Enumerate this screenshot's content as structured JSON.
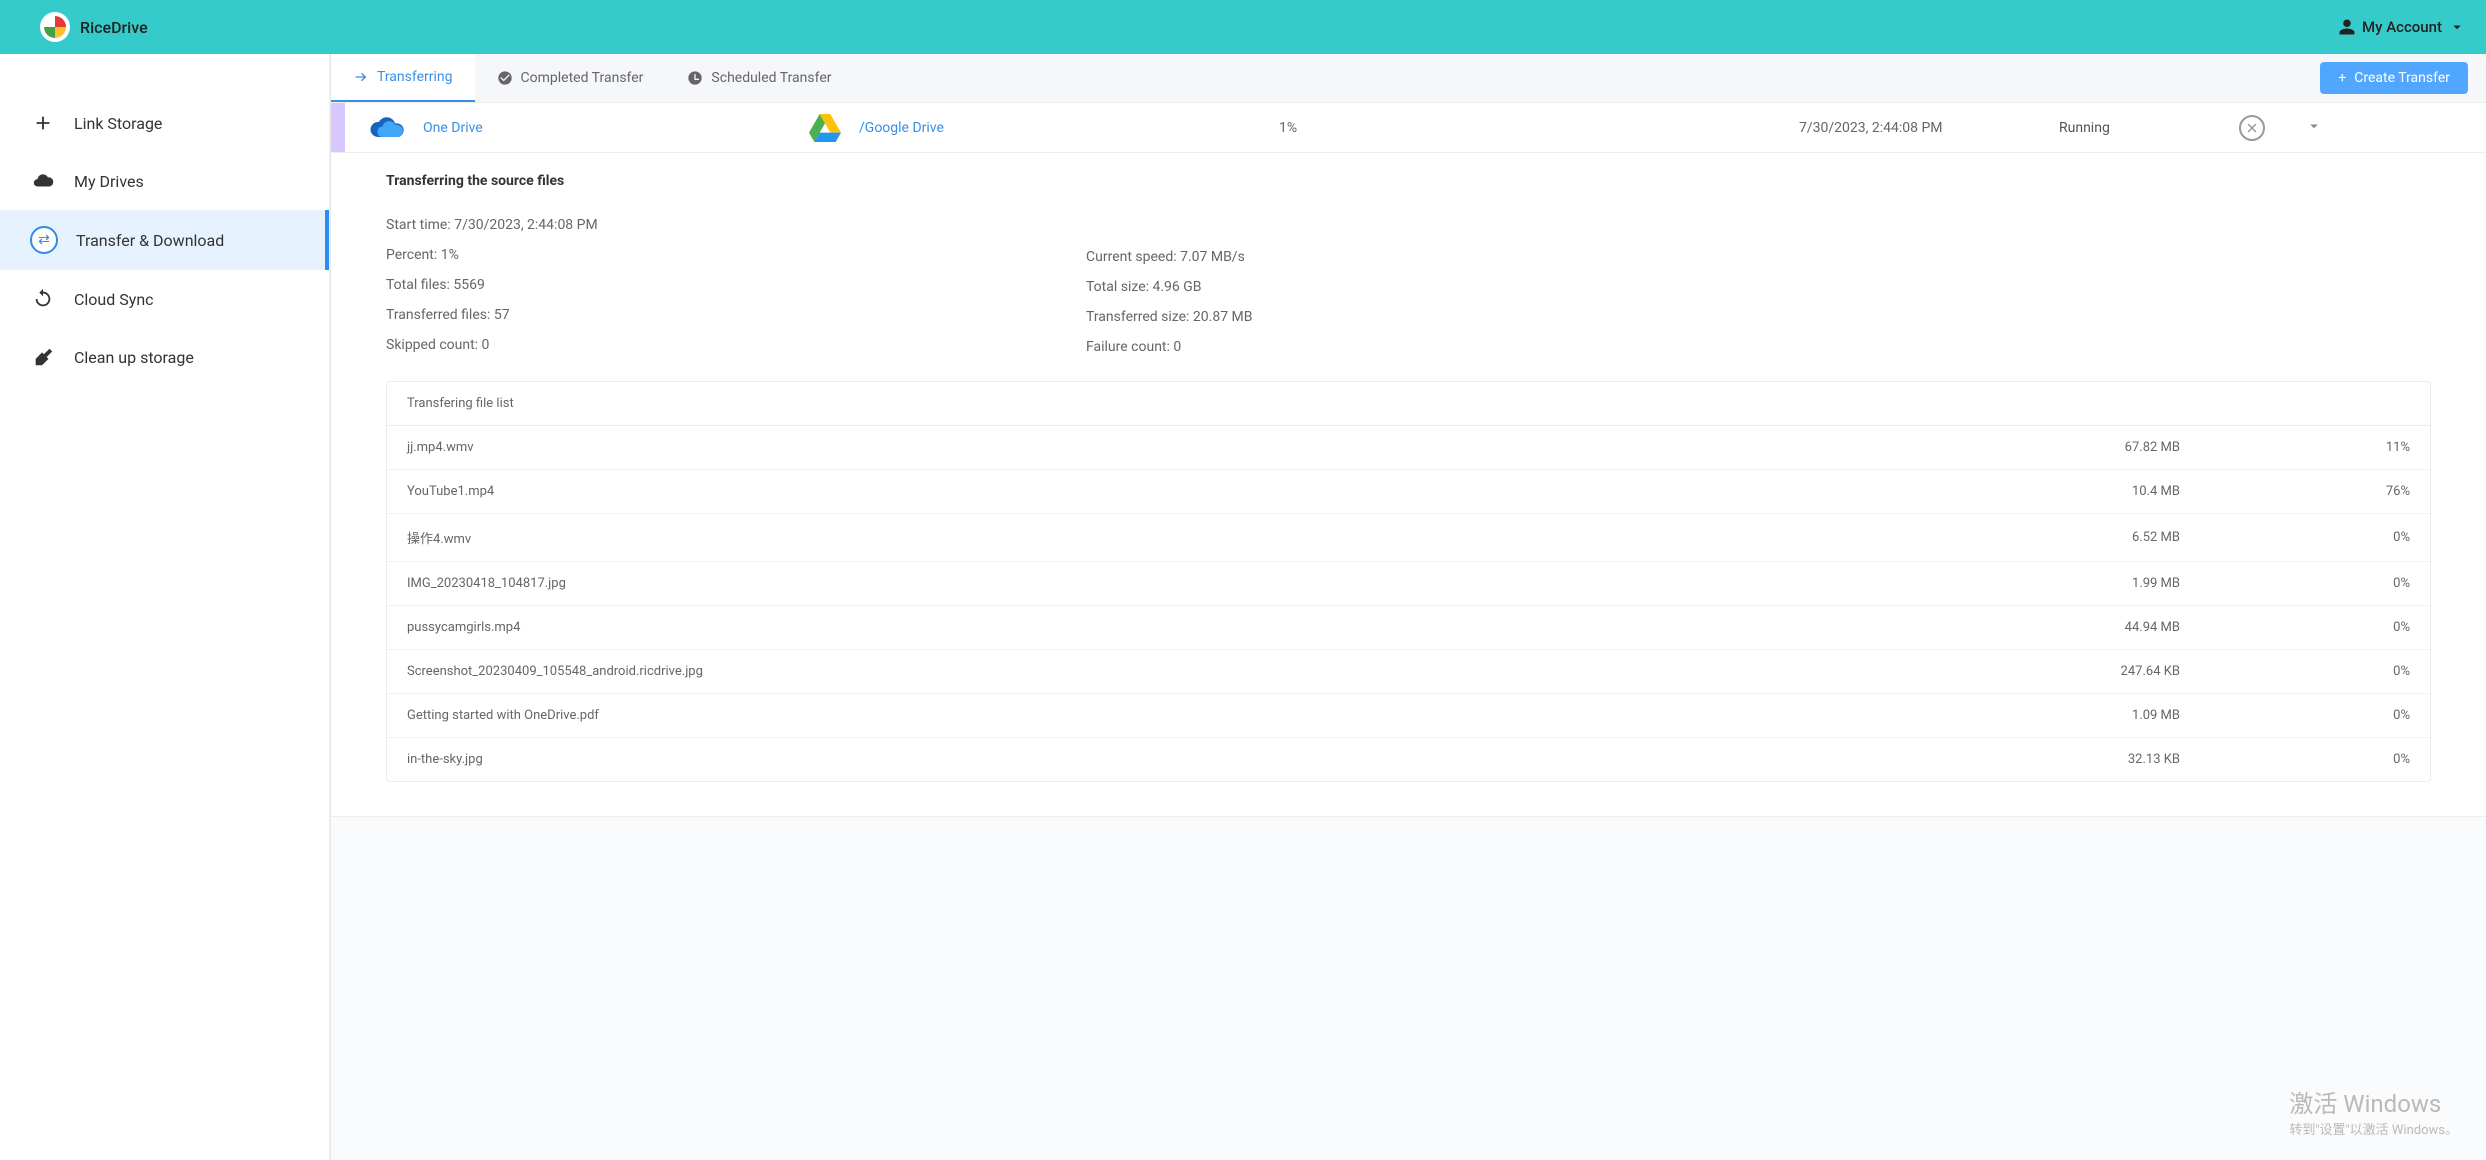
{
  "app": {
    "name": "RiceDrive",
    "account_label": "My Account"
  },
  "sidebar": {
    "items": [
      {
        "label": "Link Storage"
      },
      {
        "label": "My Drives"
      },
      {
        "label": "Transfer & Download"
      },
      {
        "label": "Cloud Sync"
      },
      {
        "label": "Clean up storage"
      }
    ]
  },
  "tabs": {
    "transferring": "Transferring",
    "completed": "Completed Transfer",
    "scheduled": "Scheduled Transfer",
    "create_btn": "Create Transfer"
  },
  "transfer": {
    "source_name": "One Drive",
    "dest_name": "/Google Drive",
    "percent": "1%",
    "time": "7/30/2023, 2:44:08 PM",
    "status": "Running"
  },
  "details": {
    "title": "Transferring the source files",
    "left": [
      "Start time: 7/30/2023, 2:44:08 PM",
      "Percent: 1%",
      "Total files: 5569",
      "Transferred files: 57",
      "Skipped count: 0"
    ],
    "right": [
      "Current speed: 7.07 MB/s",
      "Total size: 4.96 GB",
      "Transferred size: 20.87 MB",
      "Failure count: 0"
    ]
  },
  "file_list": {
    "header": "Transfering file list",
    "rows": [
      {
        "name": "jj.mp4.wmv",
        "size": "67.82 MB",
        "pct": "11%"
      },
      {
        "name": "YouTube1.mp4",
        "size": "10.4 MB",
        "pct": "76%"
      },
      {
        "name": "操作4.wmv",
        "size": "6.52 MB",
        "pct": "0%"
      },
      {
        "name": "IMG_20230418_104817.jpg",
        "size": "1.99 MB",
        "pct": "0%"
      },
      {
        "name": "pussycamgirls.mp4",
        "size": "44.94 MB",
        "pct": "0%"
      },
      {
        "name": "Screenshot_20230409_105548_android.ricdrive.jpg",
        "size": "247.64 KB",
        "pct": "0%"
      },
      {
        "name": "Getting started with OneDrive.pdf",
        "size": "1.09 MB",
        "pct": "0%"
      },
      {
        "name": "in-the-sky.jpg",
        "size": "32.13 KB",
        "pct": "0%"
      }
    ]
  },
  "watermark": {
    "l1": "激活 Windows",
    "l2": "转到\"设置\"以激活 Windows。"
  }
}
